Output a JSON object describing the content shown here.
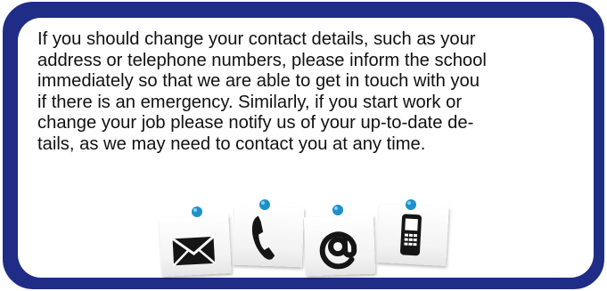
{
  "notice": {
    "lines": [
      "If you should change your contact details, such as your",
      "address or telephone numbers, please inform the school",
      "immediately so that we are able to get in touch with you",
      "if there is an emergency. Similarly, if you start work or",
      "change your job please notify us of your up-to-date de-",
      "tails, as we may need to contact you at any time."
    ]
  },
  "icons": [
    "envelope-icon",
    "phone-icon",
    "at-sign-icon",
    "mobile-phone-icon"
  ],
  "colors": {
    "border": "#1f2d86",
    "pin": "#1e90c8",
    "icon": "#151515"
  }
}
